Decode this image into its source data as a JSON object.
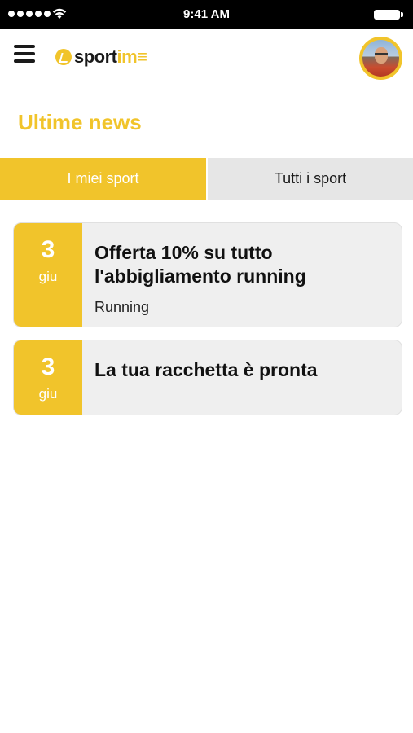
{
  "status_bar": {
    "time": "9:41 AM",
    "signal_icon": "signal-dots-icon",
    "wifi_icon": "wifi-icon",
    "battery_icon": "battery-icon"
  },
  "header": {
    "menu_icon": "hamburger-menu-icon",
    "logo": {
      "mark": "sportime-logo-mark",
      "text_dark": "sport",
      "text_light": "im≡"
    },
    "avatar": "user-avatar"
  },
  "page_title": "Ultime news",
  "tabs": [
    {
      "label": "I miei sport",
      "active": true
    },
    {
      "label": "Tutti i sport",
      "active": false
    }
  ],
  "news": [
    {
      "day": "3",
      "month": "giu",
      "title": "Offerta 10% su tutto l'abbigliamento running",
      "tag": "Running"
    },
    {
      "day": "3",
      "month": "giu",
      "title": "La tua racchetta è pronta",
      "tag": ""
    }
  ],
  "colors": {
    "accent": "#f1c42b",
    "card_background": "#efefef",
    "inactive_tab": "#e6e6e6",
    "status_bar": "#000000"
  }
}
